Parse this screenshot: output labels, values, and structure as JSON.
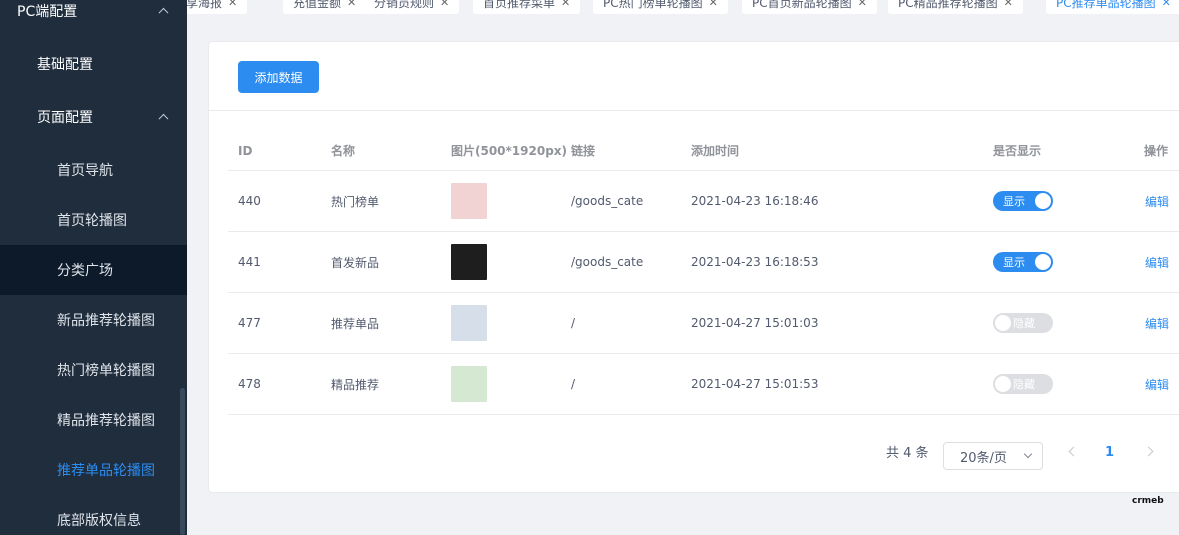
{
  "sidebar": {
    "top": {
      "label": "PC端配置"
    },
    "basic": {
      "label": "基础配置"
    },
    "page": {
      "label": "页面配置"
    },
    "items": [
      {
        "label": "首页导航"
      },
      {
        "label": "首页轮播图"
      },
      {
        "label": "分类广场"
      },
      {
        "label": "新品推荐轮播图"
      },
      {
        "label": "热门榜单轮播图"
      },
      {
        "label": "精品推荐轮播图"
      },
      {
        "label": "推荐单品轮播图"
      },
      {
        "label": "底部版权信息"
      }
    ]
  },
  "tags": [
    {
      "label": "分享海报"
    },
    {
      "label": "充值金额"
    },
    {
      "label": "分销员规则"
    },
    {
      "label": "首页推荐菜单"
    },
    {
      "label": "PC热门榜单轮播图"
    },
    {
      "label": "PC首页新品轮播图"
    },
    {
      "label": "PC精品推荐轮播图"
    },
    {
      "label": "PC推荐单品轮播图"
    }
  ],
  "toolbar": {
    "add_label": "添加数据"
  },
  "table": {
    "headers": {
      "id": "ID",
      "name": "名称",
      "image": "图片(500*1920px)",
      "link": "链接",
      "time": "添加时间",
      "show": "是否显示",
      "action": "操作"
    },
    "rows": [
      {
        "id": "440",
        "name": "热门榜单",
        "link": "/goods_cate",
        "time": "2021-04-23 16:18:46",
        "show": "显示",
        "action": "编辑",
        "thumb_color": "#f2d3d3"
      },
      {
        "id": "441",
        "name": "首发新品",
        "link": "/goods_cate",
        "time": "2021-04-23 16:18:53",
        "show": "显示",
        "action": "编辑",
        "thumb_color": "#1e1e1e"
      },
      {
        "id": "477",
        "name": "推荐单品",
        "link": "/",
        "time": "2021-04-27 15:01:03",
        "show": "隐藏",
        "action": "编辑",
        "thumb_color": "#d6dee9"
      },
      {
        "id": "478",
        "name": "精品推荐",
        "link": "/",
        "time": "2021-04-27 15:01:53",
        "show": "隐藏",
        "action": "编辑",
        "thumb_color": "#d4e8d2"
      }
    ]
  },
  "pagination": {
    "total": "共 4 条",
    "page_size": "20条/页",
    "current": "1"
  },
  "brand": {
    "text": "crmeb"
  },
  "colors": {
    "accent": "#2d8cf0",
    "sidebar_bg": "#1f2d3d"
  }
}
